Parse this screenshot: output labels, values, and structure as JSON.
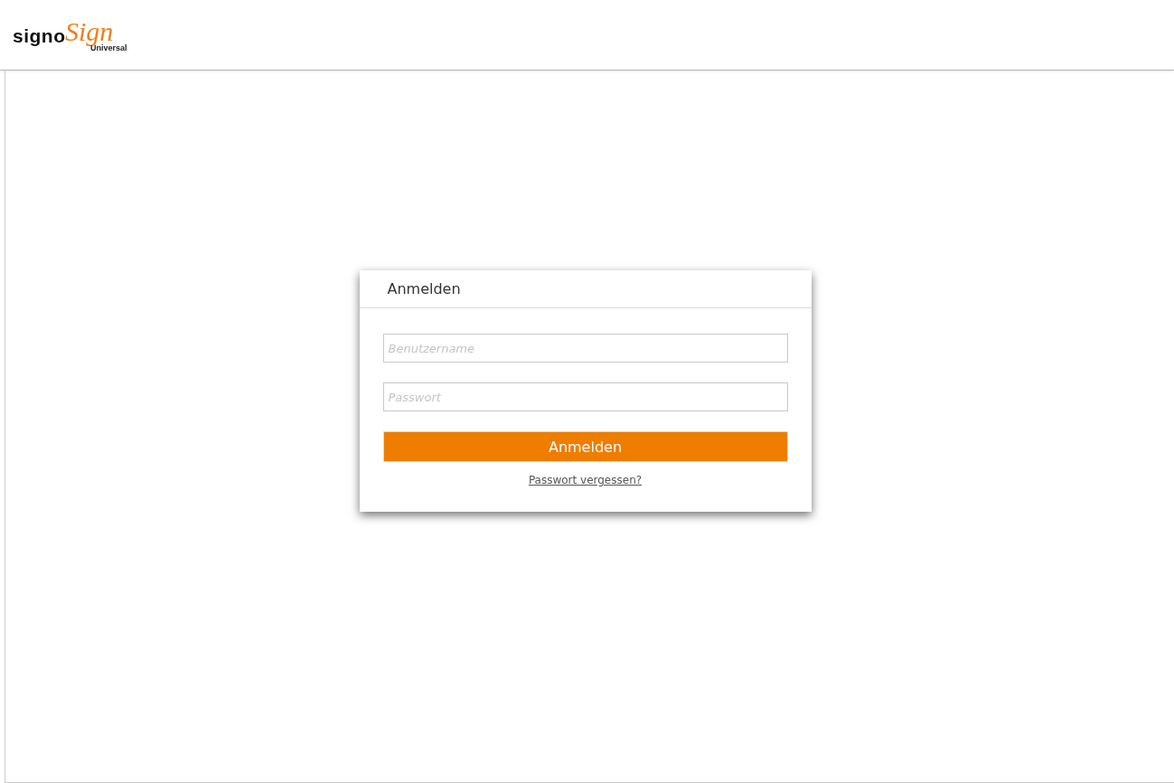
{
  "logo": {
    "part_1": "signo",
    "part_2": "Sign",
    "part_3": "Universal"
  },
  "login": {
    "title": "Anmelden",
    "fields": [
      {
        "placeholder": "Benutzername"
      },
      {
        "placeholder": "Passwort"
      }
    ],
    "button": "Anmelden",
    "link": "Passwort vergessen?"
  }
}
